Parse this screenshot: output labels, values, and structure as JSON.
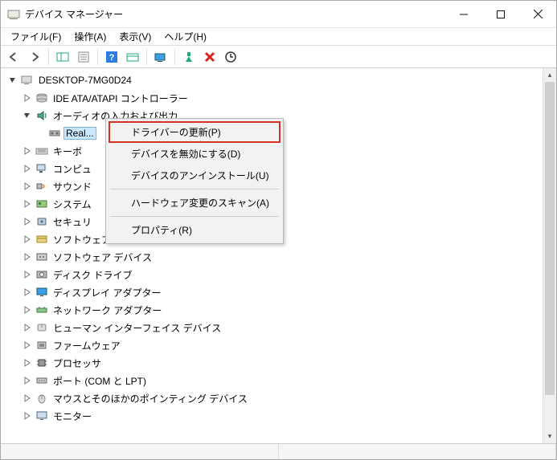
{
  "window": {
    "title": "デバイス マネージャー"
  },
  "menubar": {
    "file": "ファイル(F)",
    "action": "操作(A)",
    "view": "表示(V)",
    "help": "ヘルプ(H)"
  },
  "tree": {
    "root": "DESKTOP-7MG0D24",
    "nodes": [
      {
        "label": "IDE ATA/ATAPI コントローラー",
        "expanded": false,
        "icon": "disk"
      },
      {
        "label": "オーディオの入力および出力",
        "expanded": true,
        "icon": "audio",
        "children": [
          {
            "label": "Real...",
            "icon": "speaker",
            "selected": true
          }
        ]
      },
      {
        "label": "キーボ",
        "expanded": false,
        "icon": "keyboard"
      },
      {
        "label": "コンピュ",
        "expanded": false,
        "icon": "computer"
      },
      {
        "label": "サウンド",
        "expanded": false,
        "icon": "sound"
      },
      {
        "label": "システム",
        "expanded": false,
        "icon": "system"
      },
      {
        "label": "セキュリ",
        "expanded": false,
        "icon": "security"
      },
      {
        "label": "ソフトウェア コンポーネント",
        "expanded": false,
        "icon": "swcomp"
      },
      {
        "label": "ソフトウェア デバイス",
        "expanded": false,
        "icon": "swdev"
      },
      {
        "label": "ディスク ドライブ",
        "expanded": false,
        "icon": "diskdrive"
      },
      {
        "label": "ディスプレイ アダプター",
        "expanded": false,
        "icon": "display"
      },
      {
        "label": "ネットワーク アダプター",
        "expanded": false,
        "icon": "network"
      },
      {
        "label": "ヒューマン インターフェイス デバイス",
        "expanded": false,
        "icon": "hid"
      },
      {
        "label": "ファームウェア",
        "expanded": false,
        "icon": "firmware"
      },
      {
        "label": "プロセッサ",
        "expanded": false,
        "icon": "cpu"
      },
      {
        "label": "ポート (COM と LPT)",
        "expanded": false,
        "icon": "port"
      },
      {
        "label": "マウスとそのほかのポインティング デバイス",
        "expanded": false,
        "icon": "mouse"
      },
      {
        "label": "モニター",
        "expanded": false,
        "icon": "monitor"
      }
    ]
  },
  "context_menu": {
    "update_driver": "ドライバーの更新(P)",
    "disable": "デバイスを無効にする(D)",
    "uninstall": "デバイスのアンインストール(U)",
    "scan": "ハードウェア変更のスキャン(A)",
    "properties": "プロパティ(R)"
  }
}
